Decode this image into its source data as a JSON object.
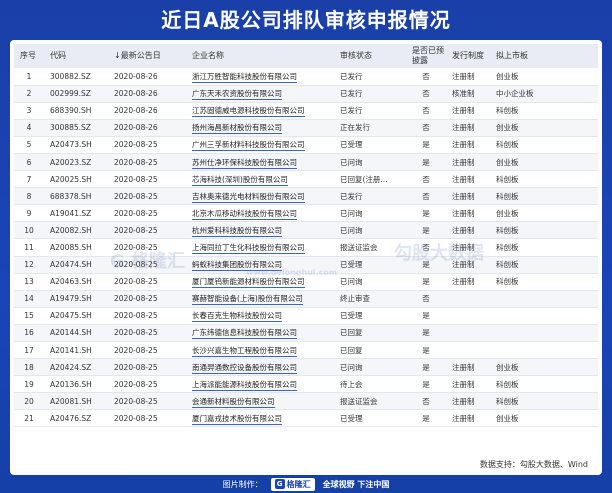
{
  "title": "近日A股公司排队审核申报情况",
  "headers": {
    "idx": "序号",
    "code": "代码",
    "date": "↓最新公告日",
    "name": "企业名称",
    "status": "审核状态",
    "disclosed": "是否已预披露",
    "system": "发行制度",
    "board": "拟上市板"
  },
  "rows": [
    {
      "idx": "1",
      "code": "300882.SZ",
      "date": "2020-08-26",
      "name": "浙江万胜智能科技股份有限公司",
      "status": "已发行",
      "disclosed": "否",
      "system": "注册制",
      "board": "创业板"
    },
    {
      "idx": "2",
      "code": "002999.SZ",
      "date": "2020-08-26",
      "name": "广东天禾农资股份有限公司",
      "status": "已发行",
      "disclosed": "否",
      "system": "核准制",
      "board": "中小企业板"
    },
    {
      "idx": "3",
      "code": "688390.SH",
      "date": "2020-08-26",
      "name": "江苏固德威电源科技股份有限公司",
      "status": "已发行",
      "disclosed": "否",
      "system": "注册制",
      "board": "科创板"
    },
    {
      "idx": "4",
      "code": "300885.SZ",
      "date": "2020-08-26",
      "name": "扬州海昌新材股份有限公司",
      "status": "正在发行",
      "disclosed": "否",
      "system": "注册制",
      "board": "创业板"
    },
    {
      "idx": "5",
      "code": "A20473.SH",
      "date": "2020-08-25",
      "name": "广州三孚新材料科技股份有限公司",
      "status": "已受理",
      "disclosed": "是",
      "system": "注册制",
      "board": "科创板"
    },
    {
      "idx": "6",
      "code": "A20023.SZ",
      "date": "2020-08-25",
      "name": "苏州仕净环保科技股份有限公司",
      "status": "已问询",
      "disclosed": "是",
      "system": "注册制",
      "board": "创业板"
    },
    {
      "idx": "7",
      "code": "A20025.SH",
      "date": "2020-08-25",
      "name": "芯海科技(深圳)股份有限公司",
      "status": "已回复(注册...",
      "disclosed": "否",
      "system": "注册制",
      "board": "科创板"
    },
    {
      "idx": "8",
      "code": "688378.SH",
      "date": "2020-08-25",
      "name": "吉林奥来德光电材料股份有限公司",
      "status": "已发行",
      "disclosed": "否",
      "system": "注册制",
      "board": "科创板"
    },
    {
      "idx": "9",
      "code": "A19041.SZ",
      "date": "2020-08-25",
      "name": "北京木瓜移动科技股份有限公司",
      "status": "已问询",
      "disclosed": "是",
      "system": "注册制",
      "board": "创业板"
    },
    {
      "idx": "10",
      "code": "A20082.SH",
      "date": "2020-08-25",
      "name": "杭州爱科科技股份有限公司",
      "status": "已问询",
      "disclosed": "是",
      "system": "注册制",
      "board": "科创板"
    },
    {
      "idx": "11",
      "code": "A20085.SH",
      "date": "2020-08-25",
      "name": "上海同拉丁生化科技股份有限公司",
      "status": "报送证监会",
      "disclosed": "否",
      "system": "注册制",
      "board": "科创板"
    },
    {
      "idx": "12",
      "code": "A20474.SH",
      "date": "2020-08-25",
      "name": "蚂蚁科技集团股份有限公司",
      "status": "已受理",
      "disclosed": "是",
      "system": "注册制",
      "board": "科创板"
    },
    {
      "idx": "13",
      "code": "A20463.SH",
      "date": "2020-08-25",
      "name": "厦门厦钨新能源材料股份有限公司",
      "status": "已问询",
      "disclosed": "是",
      "system": "注册制",
      "board": "科创板"
    },
    {
      "idx": "14",
      "code": "A19479.SH",
      "date": "2020-08-25",
      "name": "赛赫智能设备(上海)股份有限公司",
      "status": "终止审查",
      "disclosed": "否",
      "system": "",
      "board": ""
    },
    {
      "idx": "15",
      "code": "A20475.SH",
      "date": "2020-08-25",
      "name": "长春百克生物科技股份公司",
      "status": "已受理",
      "disclosed": "是",
      "system": "",
      "board": ""
    },
    {
      "idx": "16",
      "code": "A20144.SH",
      "date": "2020-08-25",
      "name": "广东纬德信息科技股份有限公司",
      "status": "已回复",
      "disclosed": "是",
      "system": "",
      "board": ""
    },
    {
      "idx": "17",
      "code": "A20141.SH",
      "date": "2020-08-25",
      "name": "长沙兴嘉生物工程股份有限公司",
      "status": "已回复",
      "disclosed": "是",
      "system": "",
      "board": ""
    },
    {
      "idx": "18",
      "code": "A20424.SZ",
      "date": "2020-08-25",
      "name": "南通羿通数控设备股份有限公司",
      "status": "已问询",
      "disclosed": "是",
      "system": "注册制",
      "board": "创业板"
    },
    {
      "idx": "19",
      "code": "A20136.SH",
      "date": "2020-08-25",
      "name": "上海派能能源科技股份有限公司",
      "status": "待上会",
      "disclosed": "是",
      "system": "注册制",
      "board": "科创板"
    },
    {
      "idx": "20",
      "code": "A20081.SH",
      "date": "2020-08-25",
      "name": "会通新材料股份有限公司",
      "status": "报送证监会",
      "disclosed": "否",
      "system": "注册制",
      "board": "科创板"
    },
    {
      "idx": "21",
      "code": "A20476.SZ",
      "date": "2020-08-25",
      "name": "厦门嘉戎技术股份有限公司",
      "status": "已受理",
      "disclosed": "是",
      "system": "注册制",
      "board": "创业板"
    }
  ],
  "source": "数据支持：勾股大数据、Wind",
  "watermarks": {
    "left": "G 格隆汇",
    "right": "勾股大数据",
    "mid": "www.gelonghui.com"
  },
  "footer": {
    "made_by": "图片制作：",
    "logo_mark": "G",
    "logo_text": "格隆汇",
    "slogan": "全球视野 下注中国"
  },
  "colors": {
    "background": "#1a45b8",
    "header_bg": "#e9ecf4",
    "underline": "#3a64c8"
  }
}
